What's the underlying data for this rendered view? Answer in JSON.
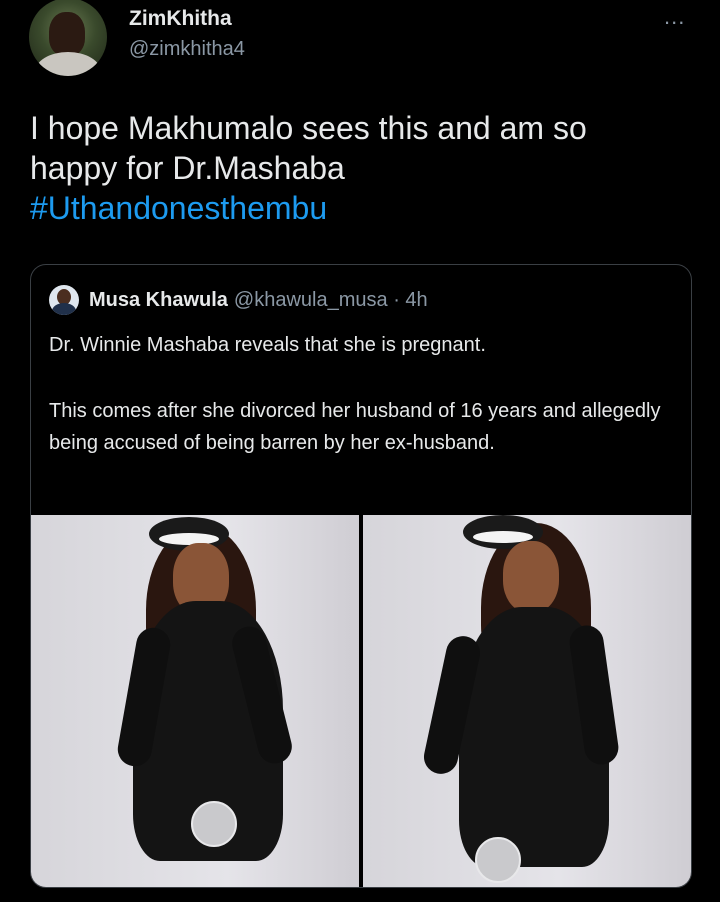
{
  "tweet": {
    "display_name": "ZimKhitha",
    "handle": "@zimkhitha4",
    "more_icon": "...",
    "text_line1": "I hope Makhumalo sees this and am so",
    "text_line2": "happy for Dr.Mashaba",
    "hashtag": "#Uthandonesthembu"
  },
  "quote": {
    "name": "Musa Khawula",
    "meta": "@khawula_musa · 4h",
    "paragraph1": "Dr. Winnie Mashaba reveals that she is pregnant.",
    "paragraph2": "This comes after she divorced her husband of 16 years and allegedly being accused of being barren by her ex-husband.",
    "photos": [
      "woman-in-black-dress-photo",
      "woman-in-black-dress-photo"
    ]
  },
  "colors": {
    "background": "#000000",
    "text": "#e7e9ea",
    "secondary": "#8b98a5",
    "link": "#1d9bf0",
    "border": "#3a3f44"
  }
}
